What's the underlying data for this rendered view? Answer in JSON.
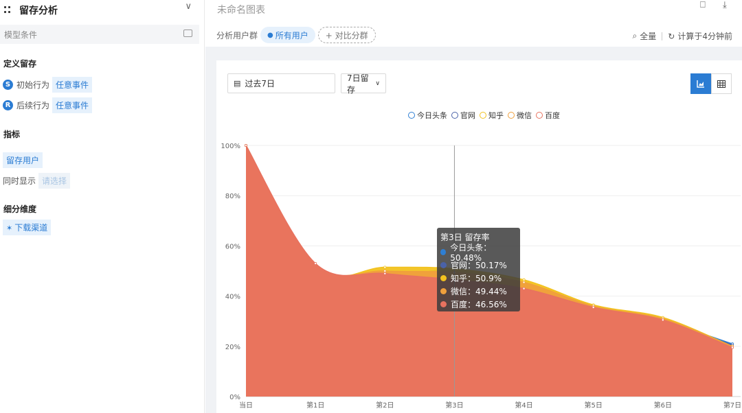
{
  "left_panel": {
    "title": "留存分析",
    "model_conditions": "模型条件",
    "define_retention": "定义留存",
    "initial_behavior": {
      "badge": "S",
      "label": "初始行为",
      "value": "任意事件"
    },
    "return_behavior": {
      "badge": "R",
      "label": "后续行为",
      "value": "任意事件"
    },
    "metrics_title": "指标",
    "metric_chip": "留存用户",
    "show_also_label": "同时显示",
    "show_also_placeholder": "请选择",
    "breakdown_title": "细分维度",
    "breakdown_chip": "下载渠道"
  },
  "header": {
    "chart_title": "未命名图表",
    "user_group_label": "分析用户群",
    "all_users": "所有用户",
    "compare_group": "+ 对比分群",
    "full_screen": "全量",
    "computed_at": "计算于4分钟前"
  },
  "controls": {
    "date_range": "过去7日",
    "retention_type": "7日留存"
  },
  "colors": {
    "今日头条": "#2f7fd3",
    "官网": "#4a62a8",
    "知乎": "#f2c21f",
    "微信": "#f0a03c",
    "百度": "#e8725f",
    "accent": "#2b7cd3"
  },
  "chart_data": {
    "type": "area",
    "categories": [
      "当日",
      "第1日",
      "第2日",
      "第3日",
      "第4日",
      "第5日",
      "第6日",
      "第7日"
    ],
    "yticks": [
      "0%",
      "20%",
      "40%",
      "60%",
      "80%",
      "100%"
    ],
    "ylim": [
      0,
      100
    ],
    "legend": "top-center",
    "grid": true,
    "series": [
      {
        "name": "今日头条",
        "values": [
          100,
          52,
          48,
          50.48,
          45,
          36,
          30,
          21
        ]
      },
      {
        "name": "官网",
        "values": [
          100,
          52,
          47.5,
          50.17,
          44,
          34.5,
          29.5,
          20.5
        ]
      },
      {
        "name": "知乎",
        "values": [
          100,
          51,
          51.5,
          50.9,
          46.5,
          36.5,
          31.5,
          20
        ]
      },
      {
        "name": "微信",
        "values": [
          100,
          52.5,
          50,
          49.44,
          45.5,
          36,
          31,
          20
        ]
      },
      {
        "name": "百度",
        "values": [
          100,
          53,
          49,
          46.56,
          43,
          35.5,
          30.5,
          19.5
        ]
      }
    ]
  },
  "tooltip": {
    "header": "第3日 留存率",
    "rows": [
      "今日头条：50.48%",
      "官网：50.17%",
      "知乎：50.9%",
      "微信：49.44%",
      "百度：46.56%"
    ]
  }
}
